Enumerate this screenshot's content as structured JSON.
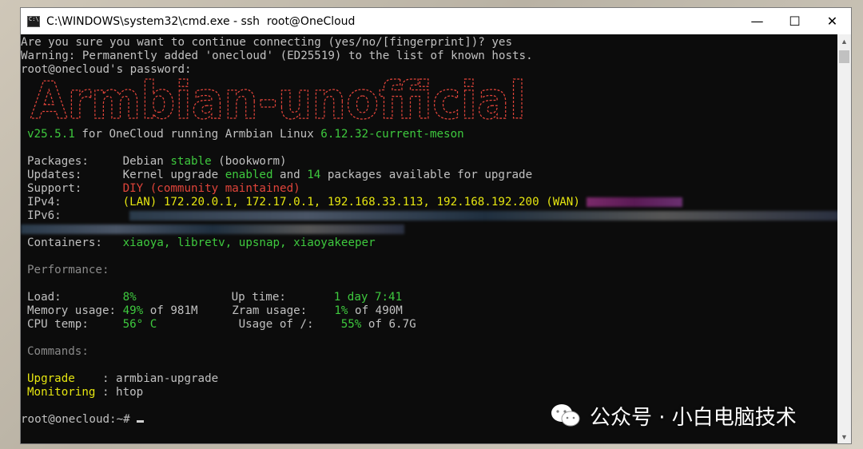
{
  "window": {
    "title": "C:\\WINDOWS\\system32\\cmd.exe - ssh  root@OneCloud",
    "controls": {
      "minimize": "—",
      "maximize": "☐",
      "close": "✕"
    }
  },
  "terminal": {
    "intro": [
      "Are you sure you want to continue connecting (yes/no/[fingerprint])? yes",
      "Warning: Permanently added 'onecloud' (ED25519) to the list of known hosts.",
      "root@onecloud's password:"
    ],
    "banner_text": "Armbian-unofficial",
    "version_line": {
      "version": "v25.5.1",
      "middle": " for OneCloud running Armbian Linux ",
      "kernel": "6.12.32-current-meson"
    },
    "packages": {
      "label": "Packages:     ",
      "distro": "Debian ",
      "status": "stable",
      "codename": " (bookworm)"
    },
    "updates": {
      "label": "Updates:      ",
      "p1": "Kernel upgrade ",
      "enabled": "enabled",
      "p2": " and ",
      "count": "14",
      "p3": " packages available for upgrade"
    },
    "support": {
      "label": "Support:      ",
      "value": "DIY (community maintained)"
    },
    "ipv4": {
      "label": "IPv4:         ",
      "lan": "(LAN) 172.20.0.1, 172.17.0.1, 192.168.33.113, 192.168.192.200 ",
      "wan": "(WAN)"
    },
    "ipv6": {
      "label": "IPv6:"
    },
    "containers": {
      "label": "Containers:   ",
      "value": "xiaoya, libretv, upsnap, xiaoyakeeper"
    },
    "performance_header": "Performance:",
    "load": {
      "label": "Load:         ",
      "value": "8%",
      "uptime_label": "Up time:       ",
      "uptime_value": "1 day 7:41"
    },
    "memory": {
      "label": "Memory usage: ",
      "value": "49%",
      "of": " of 981M     ",
      "zram_label": "Zram usage:    ",
      "zram_value": "1%",
      "zram_of": " of 490M"
    },
    "cpu": {
      "label": "CPU temp:     ",
      "value": "56° C",
      "usage_label": "Usage of /:    ",
      "usage_value": "55%",
      "usage_of": " of 6.7G"
    },
    "commands_header": "Commands:",
    "cmd_upgrade": {
      "name": "Upgrade",
      "sep": "    : ",
      "value": "armbian-upgrade"
    },
    "cmd_monitor": {
      "name": "Monitoring",
      "sep": " : ",
      "value": "htop"
    },
    "prompt": "root@onecloud:~# "
  },
  "watermark": {
    "text": "公众号 · 小白电脑技术"
  },
  "colors": {
    "green": "#3ec93e",
    "yellow": "#e5e510",
    "red": "#e0443a",
    "gray": "#8a8a8a"
  },
  "icons": {
    "app": "cmd-icon",
    "scroll_up": "scroll-up-arrow-icon",
    "scroll_down": "scroll-down-arrow-icon",
    "wechat": "wechat-icon"
  }
}
